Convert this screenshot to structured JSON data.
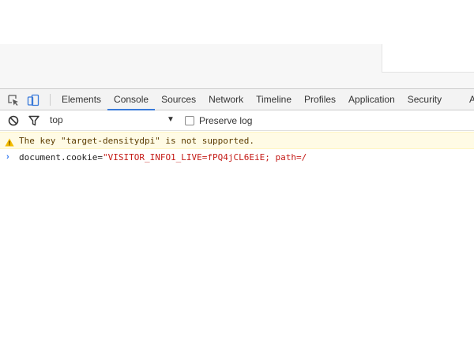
{
  "devtools": {
    "tabs": [
      {
        "label": "Elements",
        "active": false
      },
      {
        "label": "Console",
        "active": true
      },
      {
        "label": "Sources",
        "active": false
      },
      {
        "label": "Network",
        "active": false
      },
      {
        "label": "Timeline",
        "active": false
      },
      {
        "label": "Profiles",
        "active": false
      },
      {
        "label": "Application",
        "active": false
      },
      {
        "label": "Security",
        "active": false
      }
    ],
    "tab_overflow": "A",
    "icons": {
      "inspect": "inspect-element-icon",
      "device": "device-toolbar-icon",
      "clear": "clear-console-icon",
      "filter": "filter-icon",
      "warning": "warning-icon",
      "prompt": "prompt-chevron-icon"
    },
    "accent_color": "#3879d9"
  },
  "console": {
    "context": "top",
    "context_arrow": "▼",
    "preserve_log_label": "Preserve log",
    "preserve_log_checked": false,
    "warning_message": "The key \"target-densitydpi\" is not supported.",
    "input": {
      "prompt": "›",
      "code_prefix": "document.cookie=",
      "code_string": "\"VISITOR_INFO1_LIVE=fPQ4jCL6EiE; path=/"
    }
  }
}
